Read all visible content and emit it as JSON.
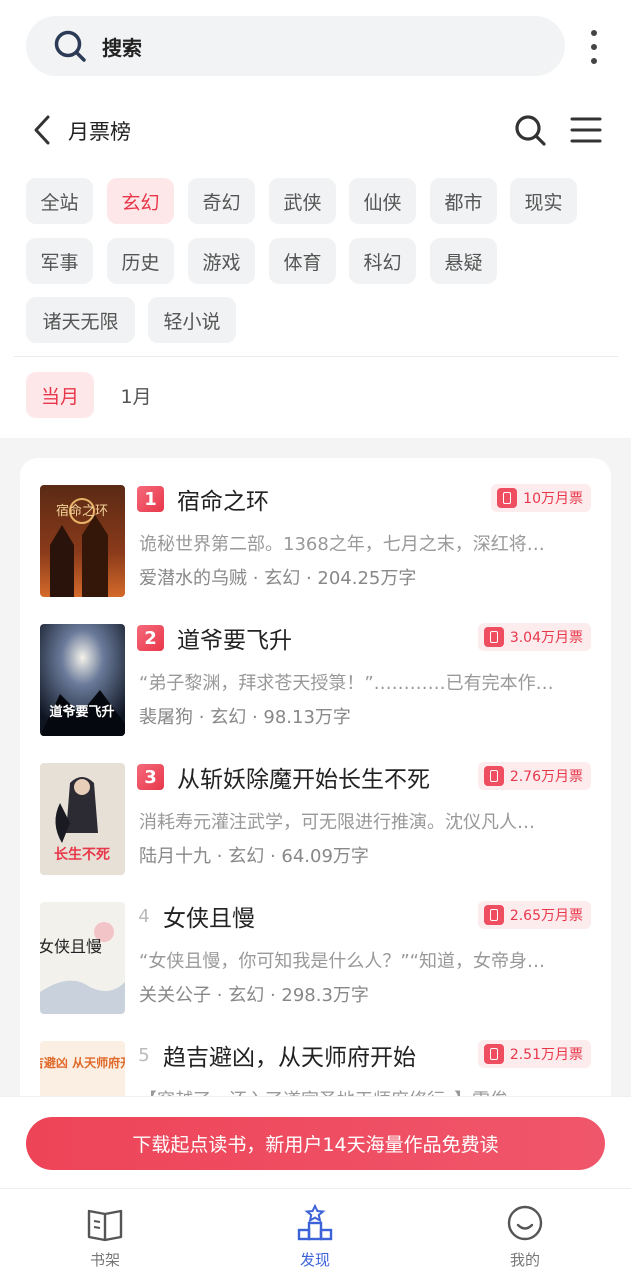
{
  "search": {
    "label": "搜索"
  },
  "header": {
    "title": "月票榜"
  },
  "categories": [
    "全站",
    "玄幻",
    "奇幻",
    "武侠",
    "仙侠",
    "都市",
    "现实",
    "军事",
    "历史",
    "游戏",
    "体育",
    "科幻",
    "悬疑",
    "诸天无限",
    "轻小说"
  ],
  "active_category": "玄幻",
  "period_tabs": [
    "当月",
    "1月"
  ],
  "active_period": "当月",
  "books": [
    {
      "rank": "1",
      "title": "宿命之环",
      "votes": "10万月票",
      "desc": "诡秘世界第二部。1368之年，七月之末，深红将…",
      "author": "爱潜水的乌贼",
      "genre": "玄幻",
      "words": "204.25万字",
      "cover_text": "宿命之环"
    },
    {
      "rank": "2",
      "title": "道爷要飞升",
      "votes": "3.04万月票",
      "desc": "“弟子黎渊，拜求苍天授箓！”…………已有完本作…",
      "author": "裴屠狗",
      "genre": "玄幻",
      "words": "98.13万字",
      "cover_text": "道爷要飞升"
    },
    {
      "rank": "3",
      "title": "从斩妖除魔开始长生不死",
      "votes": "2.76万月票",
      "desc": "消耗寿元灌注武学，可无限进行推演。沈仪凡人…",
      "author": "陆月十九",
      "genre": "玄幻",
      "words": "64.09万字",
      "cover_text": "长生不死"
    },
    {
      "rank": "4",
      "title": "女侠且慢",
      "votes": "2.65万月票",
      "desc": "“女侠且慢，你可知我是什么人？”“知道，女帝身…",
      "author": "关关公子",
      "genre": "玄幻",
      "words": "298.3万字",
      "cover_text": "女侠且慢"
    },
    {
      "rank": "5",
      "title": "趋吉避凶，从天师府开始",
      "votes": "2.51万月票",
      "desc": "【穿越了，还入了道家圣地天师府修行。】雷俊…",
      "author": "",
      "genre": "",
      "words": "",
      "cover_text": "趋吉避凶 从天师府开始"
    }
  ],
  "separator": "·",
  "download_banner": "下载起点读书，新用户14天海量作品免费读",
  "bottom_nav": [
    {
      "label": "书架",
      "icon": "book-icon"
    },
    {
      "label": "发现",
      "icon": "discover-icon"
    },
    {
      "label": "我的",
      "icon": "profile-icon"
    }
  ],
  "colors": {
    "accent": "#e8374a",
    "nav_active": "#3d63d8",
    "chip_bg": "#f1f2f3",
    "chip_active_bg": "#fde7e9"
  }
}
